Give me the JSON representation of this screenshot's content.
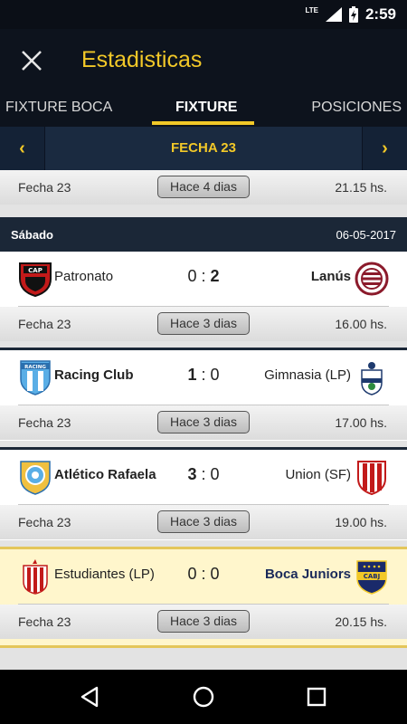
{
  "status_bar": {
    "network": "LTE",
    "time": "2:59"
  },
  "app_bar": {
    "title": "Estadisticas",
    "close_icon": "close-icon"
  },
  "tabs": [
    {
      "label": "FIXTURE BOCA",
      "active": false
    },
    {
      "label": "FIXTURE",
      "active": true
    },
    {
      "label": "POSICIONES",
      "active": false
    }
  ],
  "round_nav": {
    "label": "FECHA 23",
    "prev": "‹",
    "next": "›"
  },
  "top_info": {
    "fecha": "Fecha 23",
    "ago": "Hace 4 dias",
    "hora": "21.15 hs."
  },
  "day_header": {
    "day": "Sábado",
    "date": "06-05-2017"
  },
  "matches": [
    {
      "home": "Patronato",
      "home_score": "0",
      "away_score": "2",
      "away": "Lanús",
      "fecha": "Fecha 23",
      "ago": "Hace 3 dias",
      "hora": "16.00 hs."
    },
    {
      "home": "Racing Club",
      "home_score": "1",
      "away_score": "0",
      "away": "Gimnasia (LP)",
      "fecha": "Fecha 23",
      "ago": "Hace 3 dias",
      "hora": "17.00 hs."
    },
    {
      "home": "Atlético Rafaela",
      "home_score": "3",
      "away_score": "0",
      "away": "Union (SF)",
      "fecha": "Fecha 23",
      "ago": "Hace 3 dias",
      "hora": "19.00 hs."
    },
    {
      "home": "Estudiantes (LP)",
      "home_score": "0",
      "away_score": "0",
      "away": "Boca Juniors",
      "fecha": "Fecha 23",
      "ago": "Hace 3 dias",
      "hora": "20.15 hs."
    }
  ],
  "crest_text": {
    "patronato": "CAP",
    "racing": "RACING",
    "boca": "CABJ"
  },
  "colors": {
    "accent": "#f2c828",
    "dark_bg": "#0d131d",
    "highlight": "#fff6cc"
  }
}
